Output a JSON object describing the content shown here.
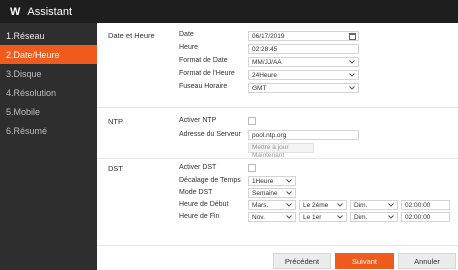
{
  "window": {
    "logo": "W",
    "title": "Assistant"
  },
  "sidebar": {
    "items": [
      {
        "label": "1.Réseau"
      },
      {
        "label": "2.Date/Heure"
      },
      {
        "label": "3.Disque"
      },
      {
        "label": "4.Résolution"
      },
      {
        "label": "5.Mobile"
      },
      {
        "label": "6.Résumé"
      }
    ]
  },
  "datetime": {
    "section": "Date et Heure",
    "date_label": "Date",
    "date_value": "06/17/2019",
    "time_label": "Heure",
    "time_value": "02:28:45",
    "date_format_label": "Format de Date",
    "date_format_value": "MM/JJ/AA",
    "time_format_label": "Format de l'Heure",
    "time_format_value": "24Heure",
    "timezone_label": "Fuseau Horaire",
    "timezone_value": "GMT"
  },
  "ntp": {
    "section": "NTP",
    "enable_label": "Activer NTP",
    "server_label": "Adresse du Serveur",
    "server_value": "pool.ntp.org",
    "update_button": "Mettre à jour Maintenant"
  },
  "dst": {
    "section": "DST",
    "enable_label": "Activer DST",
    "offset_label": "Décalage de Temps",
    "offset_value": "1Heure",
    "mode_label": "Mode DST",
    "mode_value": "Semaine",
    "start_label": "Heure de Début",
    "start_month": "Mars.",
    "start_week": "Le 2ème",
    "start_day": "Dim.",
    "start_time": "02:00:00",
    "end_label": "Heure de Fin",
    "end_month": "Nov.",
    "end_week": "Le 1er",
    "end_day": "Dim.",
    "end_time": "02:00:00"
  },
  "footer": {
    "prev": "Précédent",
    "next": "Suivant",
    "cancel": "Annuler"
  },
  "colors": {
    "accent": "#ef5b1c",
    "sidebar": "#2e2e2e",
    "titlebar": "#1e1e1e"
  }
}
